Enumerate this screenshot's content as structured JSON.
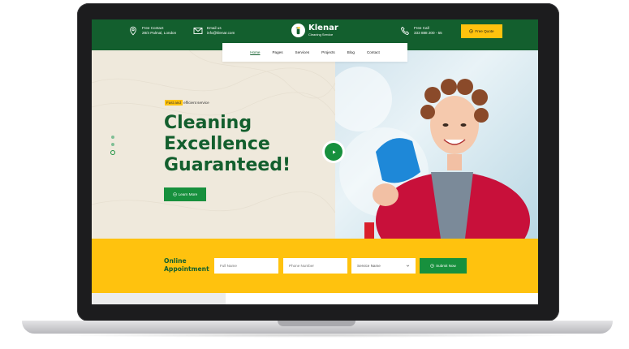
{
  "header": {
    "contact": {
      "label": "Free Contact",
      "value": "28/4 Palmal, London"
    },
    "email": {
      "label": "Email us",
      "value": "info@klenar.com"
    },
    "brand": {
      "name": "Klenar",
      "tagline": "Cleaning Service"
    },
    "call": {
      "label": "Free Call",
      "value": "333 888 200 - 55"
    },
    "quote_button": "Free Quote"
  },
  "nav": {
    "items": [
      "Home",
      "Pages",
      "Services",
      "Projects",
      "Blog",
      "Contact"
    ],
    "active": "Home"
  },
  "hero": {
    "badge_highlight": "Fast and",
    "badge_rest": " efficient service",
    "title_lines": [
      "Cleaning",
      "Excellence",
      "Guaranteed!"
    ],
    "cta": "Learn More"
  },
  "appointment": {
    "title_lines": [
      "Online",
      "Appointment"
    ],
    "full_name_placeholder": "Full Name",
    "phone_placeholder": "Phone Number",
    "service_select": "Service Name",
    "submit": "Submit Now"
  },
  "colors": {
    "primary": "#135f2e",
    "accent": "#ffc20e",
    "button": "#17903d"
  },
  "icons": [
    "location-pin-icon",
    "envelope-icon",
    "phone-icon",
    "spray-bottle-icon",
    "play-icon",
    "arrow-circle-icon",
    "chevron-down-icon"
  ]
}
